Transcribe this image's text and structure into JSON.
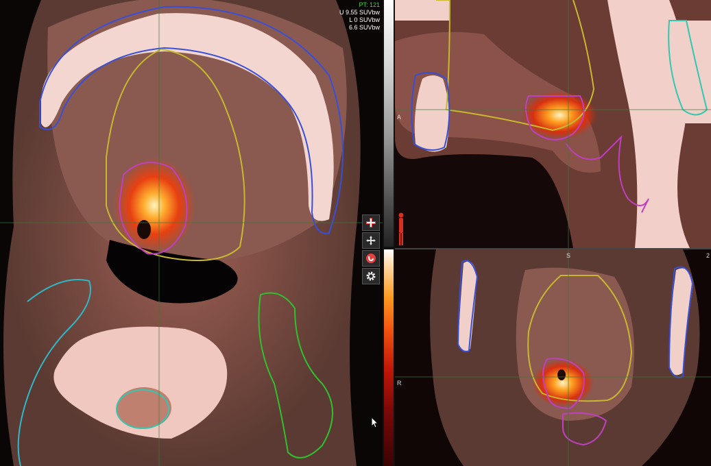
{
  "overlay": {
    "pt_label": "PT: 121",
    "upper": "U 9.55 SUVbw",
    "lower": "L 0 SUVbw",
    "window": "6.6 SUVbw"
  },
  "orientation": {
    "sagittal_left": "A",
    "coronal_top": "S",
    "coronal_left": "R",
    "coronal_right_num": "2"
  },
  "toolbar": {
    "tools": [
      {
        "name": "crosshair-tool",
        "icon": "crosshair-red-icon"
      },
      {
        "name": "pan-tool",
        "icon": "move-arrows-icon"
      },
      {
        "name": "magnet-tool",
        "icon": "magnet-icon"
      },
      {
        "name": "settings-tool",
        "icon": "gear-icon"
      }
    ]
  },
  "colors": {
    "contour_mandible": "#3a4fd8",
    "contour_tongue": "#c8b830",
    "contour_tumor": "#c040c0",
    "contour_parotid_left": "#30b8c8",
    "contour_parotid_right": "#30c030",
    "contour_spinal_cord": "#30c8b0",
    "crosshair": "#3a7a3a"
  }
}
